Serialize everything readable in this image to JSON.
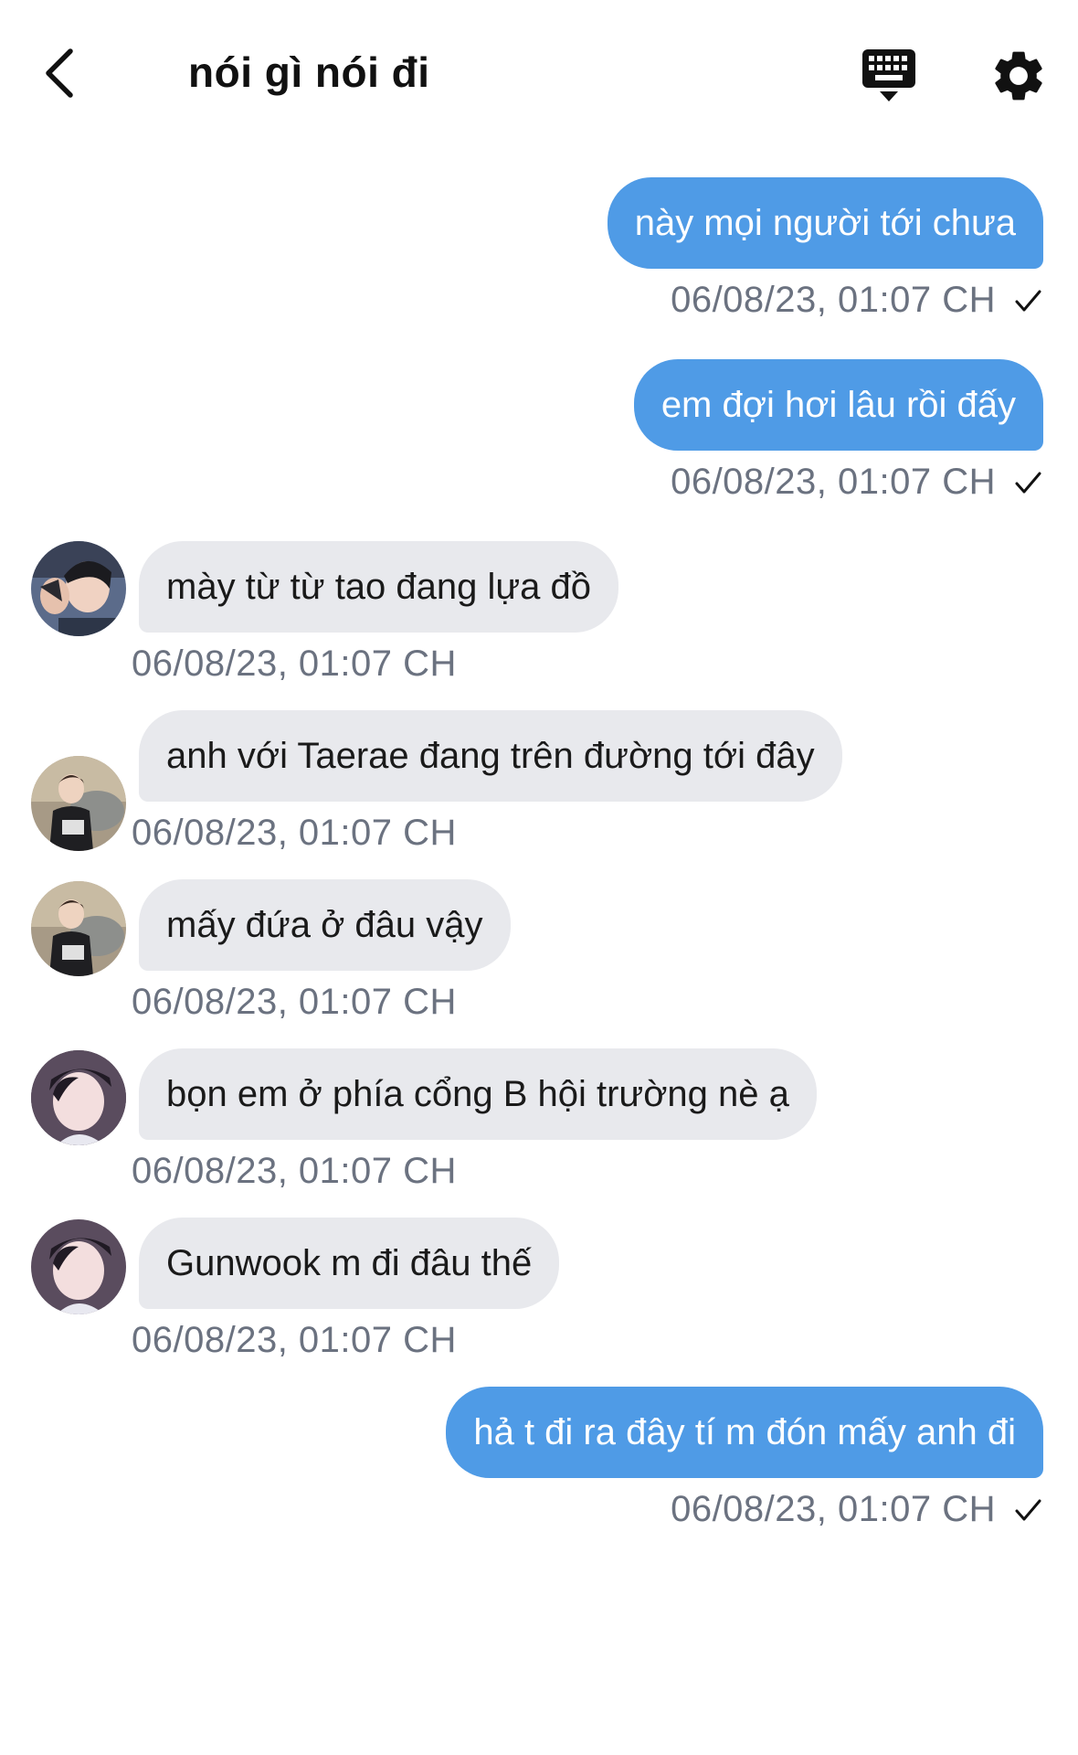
{
  "header": {
    "title": "nói gì nói đi",
    "back_icon": "chevron-left-icon",
    "keyboard_icon": "keyboard-icon",
    "settings_icon": "gear-icon"
  },
  "colors": {
    "outgoing_bubble": "#4f9be6",
    "incoming_bubble": "#e8e9ed",
    "timestamp": "#6b7280"
  },
  "messages": [
    {
      "direction": "outgoing",
      "text": "này mọi người tới chưa",
      "time": "06/08/23, 01:07 CH",
      "status": "sent"
    },
    {
      "direction": "outgoing",
      "text": "em đợi hơi lâu rồi đấy",
      "time": "06/08/23, 01:07 CH",
      "status": "sent"
    },
    {
      "direction": "incoming",
      "avatar": "avatar-1",
      "text": "mày từ từ tao đang lựa đồ",
      "time": "06/08/23, 01:07 CH"
    },
    {
      "direction": "incoming",
      "avatar": "avatar-2",
      "text": "anh với Taerae đang trên đường tới đây",
      "time": "06/08/23, 01:07 CH"
    },
    {
      "direction": "incoming",
      "avatar": "avatar-2",
      "text": "mấy đứa ở đâu vậy",
      "time": "06/08/23, 01:07 CH"
    },
    {
      "direction": "incoming",
      "avatar": "avatar-3",
      "text": "bọn em ở phía cổng B hội trường nè ạ",
      "time": "06/08/23, 01:07 CH"
    },
    {
      "direction": "incoming",
      "avatar": "avatar-3",
      "text": "Gunwook m đi đâu thế",
      "time": "06/08/23, 01:07 CH"
    },
    {
      "direction": "outgoing",
      "text": "hả t đi ra đây tí m đón mấy anh đi",
      "time": "06/08/23, 01:07 CH",
      "status": "sent"
    }
  ]
}
